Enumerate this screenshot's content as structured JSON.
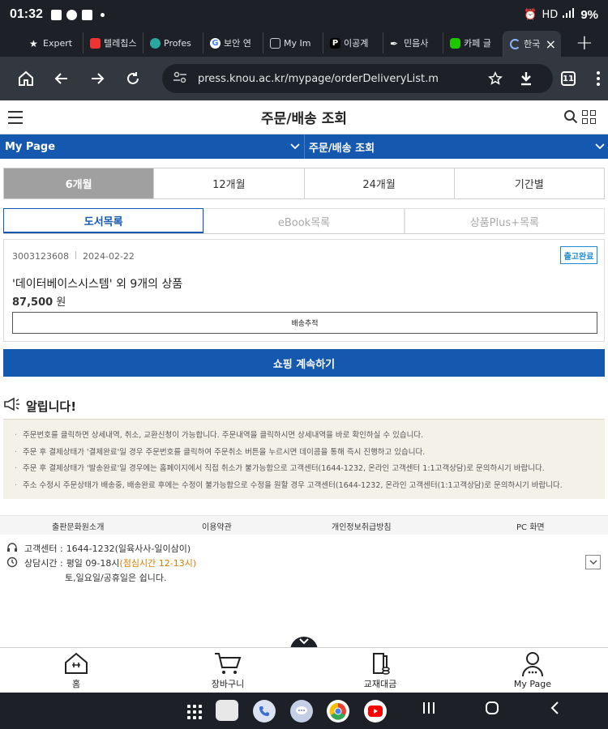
{
  "status_bar": {
    "time": "01:32",
    "battery": "9%",
    "network": "HD"
  },
  "browser": {
    "tabs": [
      {
        "label": "Expert",
        "icon": "star-icon"
      },
      {
        "label": "텔레칩스",
        "icon": "telechips-icon"
      },
      {
        "label": "Profes",
        "icon": "pentagon-icon"
      },
      {
        "label": "보안 연",
        "icon": "google-icon"
      },
      {
        "label": "My Im",
        "icon": "image-icon"
      },
      {
        "label": "이공계",
        "icon": "p-icon"
      },
      {
        "label": "민음사",
        "icon": "pen-icon"
      },
      {
        "label": "카페 글",
        "icon": "cafe-icon"
      },
      {
        "label": "한국",
        "icon": "loading-icon",
        "active": true
      }
    ],
    "url": "press.knou.ac.kr/mypage/orderDeliveryList.m",
    "tab_count": "11"
  },
  "header": {
    "title": "주문/배송 조회"
  },
  "nav": {
    "left": "My Page",
    "right": "주문/배송 조회"
  },
  "period_tabs": [
    "6개월",
    "12개월",
    "24개월",
    "기간별"
  ],
  "product_tabs": [
    "도서목록",
    "eBook목록",
    "상품Plus+목록"
  ],
  "order": {
    "order_no": "3003123608",
    "date": "2024-02-22",
    "status": "출고완료",
    "name": "'데이터베이스시스템' 외 9개의 상품",
    "price": "87,500",
    "currency": "원",
    "track_label": "배송추적"
  },
  "continue_label": "쇼핑 계속하기",
  "notice": {
    "title": "알립니다!",
    "items": [
      "주문번호를 클릭하면 상세내역, 취소, 교환신청이 가능합니다. 주문내역을 클릭하시면 상세내역을 바로 확인하실 수 있습니다.",
      "주문 후 결제상태가 '결제완료'일 경우 주문번호를 클릭하여 주문취소 버튼을 누르시면 데이콤을 통해 즉시 진행하고 있습니다.",
      "주문 후 결제상태가 '발송완료'일 경우에는 홈페이지에서 직접 취소가 불가능함으로 고객센터(1644-1232, 온라인 고객센터 1:1고객상담)로 문의하시기 바랍니다.",
      "주소 수정시 주문상태가 배송중, 배송완료 후에는 수정이 불가능함으로 수정을 원할 경우 고객센터(1644-1232, 온라인 고객센터(1:1고객상담)로 문의하시기 바랍니다."
    ]
  },
  "footer_links": [
    "출판문화원소개",
    "이용약관",
    "개인정보취급방침",
    "PC 화면"
  ],
  "customer_service": {
    "phone_label": "고객센터 :",
    "phone_value": "1644-1232(일육사사-일이삼이)",
    "hours_label": "상담시간 :",
    "hours_value": "평일 09-18시",
    "lunch": "(점심시간 12-13시)",
    "closed": "토,일요일/공휴일은 쉽니다."
  },
  "bottom_nav": [
    "홈",
    "장바구니",
    "교재대금",
    "My Page"
  ],
  "colors": {
    "brand_blue": "#1558b0",
    "badge_blue": "#1d8bd3",
    "lunch_orange": "#e07b00",
    "chrome_dark": "#1d2026"
  }
}
